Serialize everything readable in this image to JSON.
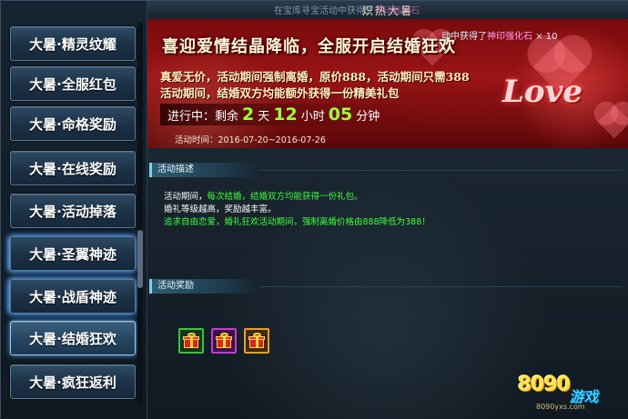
{
  "window": {
    "title": "炽热大暑",
    "marquee_prefix": "在宝库寻宝活动中获得了",
    "marquee_item": "神印强化石",
    "notice_prefix": "动中获得了",
    "notice_item": "神印强化石",
    "notice_count": "× 10"
  },
  "sidebar": {
    "tabs": [
      {
        "label": "大暑·精灵纹耀"
      },
      {
        "label": "大暑·全服红包"
      },
      {
        "label": "大暑·命格奖励"
      },
      {
        "label": "大暑·在线奖励"
      },
      {
        "label": "大暑·活动掉落"
      },
      {
        "label": "大暑·圣翼神迹"
      },
      {
        "label": "大暑·战盾神迹"
      },
      {
        "label": "大暑·结婚狂欢"
      },
      {
        "label": "大暑·疯狂返利"
      }
    ],
    "active_tab": "大暑·结婚狂欢"
  },
  "banner": {
    "headline": "喜迎爱情结晶降临，全服开启结婚狂欢",
    "line1": "真爱无价，活动期间强制离婚，原价888，活动期间只需388",
    "line2": "活动期间，结婚双方均能额外获得一份精美礼包",
    "decor_word": "Love",
    "countdown": {
      "prefix": "进行中：剩余",
      "days": "2",
      "days_unit": "天",
      "hours": "12",
      "hours_unit": "小时",
      "minutes": "05",
      "minutes_unit": "分钟"
    },
    "activity_time": "活动时间：2016-07-20~2016-07-26"
  },
  "sections": {
    "description_title": "活动描述",
    "description_lines": [
      {
        "prefix": "活动期间，",
        "highlight": "每次结婚，结婚双方均能获得一份礼包。",
        "suffix": ""
      },
      {
        "prefix": "婚礼等级越高，奖励越丰富。",
        "highlight": "",
        "suffix": ""
      },
      {
        "prefix": "",
        "highlight": "追求自由恋爱，婚礼狂欢活动期间，强制离婚价格由888降低为388！",
        "suffix": ""
      }
    ],
    "reward_title": "活动奖励",
    "rewards": [
      {
        "name": "green-gift",
        "border": "#3cc23c"
      },
      {
        "name": "purple-gift",
        "border": "#c23cd8"
      },
      {
        "name": "orange-gift",
        "border": "#e8a020"
      }
    ]
  },
  "logo": {
    "number": "8090",
    "word": "游戏",
    "url": "8090yxs.com"
  },
  "colors": {
    "highlight_green": "#3cff3c",
    "text_white": "#ffffff",
    "countdown_green": "#9dff3a"
  }
}
